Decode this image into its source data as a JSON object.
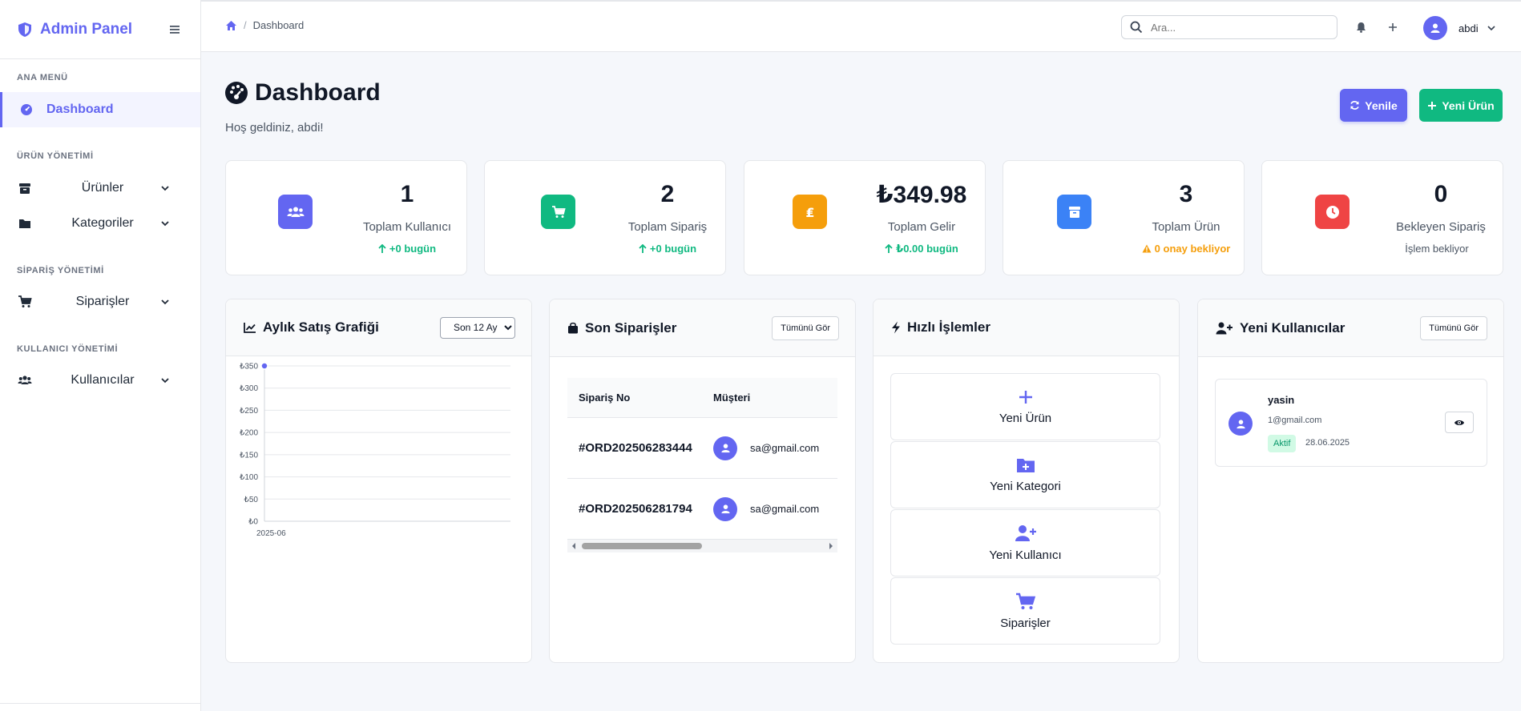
{
  "brand": {
    "title": "Admin Panel"
  },
  "sidebar": {
    "sections": [
      {
        "title": "ANA MENÜ"
      },
      {
        "title": "ÜRÜN YÖNETİMİ"
      },
      {
        "title": "SİPARİŞ YÖNETİMİ"
      },
      {
        "title": "KULLANICI YÖNETİMİ"
      }
    ],
    "items": [
      {
        "label": "Dashboard",
        "icon": "gauge-icon",
        "active": true
      },
      {
        "label": "Ürünler",
        "icon": "box-icon"
      },
      {
        "label": "Kategoriler",
        "icon": "folder-icon"
      },
      {
        "label": "Siparişler",
        "icon": "cart-icon"
      },
      {
        "label": "Kullanıcılar",
        "icon": "users-icon"
      }
    ]
  },
  "topbar": {
    "breadcrumb": "Dashboard",
    "search_placeholder": "Ara...",
    "user_name": "abdi"
  },
  "page": {
    "title": "Dashboard",
    "subtitle": "Hoş geldiniz, abdi!",
    "refresh_label": "Yenile",
    "new_product_label": "Yeni Ürün"
  },
  "stats": [
    {
      "value": "1",
      "label": "Toplam Kullanıcı",
      "sub": "+0 bugün",
      "color": "#6366f1",
      "sub_color": "#10b981"
    },
    {
      "value": "2",
      "label": "Toplam Sipariş",
      "sub": "+0 bugün",
      "color": "#10b981",
      "sub_color": "#10b981"
    },
    {
      "value": "₺349.98",
      "label": "Toplam Gelir",
      "sub": "₺0.00 bugün",
      "color": "#f59e0b",
      "sub_color": "#10b981"
    },
    {
      "value": "3",
      "label": "Toplam Ürün",
      "sub": "0 onay bekliyor",
      "color": "#3b82f6",
      "sub_color": "#f59e0b"
    },
    {
      "value": "0",
      "label": "Bekleyen Sipariş",
      "sub": "İşlem bekliyor",
      "color": "#ef4444",
      "sub_color": "#4b5563"
    }
  ],
  "sales_panel": {
    "title": "Aylık Satış Grafiği",
    "range_selected": "Son 12 Ay"
  },
  "chart_data": {
    "type": "line",
    "categories": [
      "2025-06"
    ],
    "series": [
      {
        "values": [
          349.98
        ],
        "color": "#6366f1"
      }
    ],
    "yticks": [
      "₺0",
      "₺50",
      "₺100",
      "₺150",
      "₺200",
      "₺250",
      "₺300",
      "₺350"
    ],
    "ylim": [
      0,
      350
    ],
    "grid": true
  },
  "orders_panel": {
    "title": "Son Siparişler",
    "view_all": "Tümünü Gör",
    "columns": [
      "Sipariş No",
      "Müşteri"
    ],
    "rows": [
      {
        "order_no": "#ORD202506283444",
        "customer": "sa@gmail.com"
      },
      {
        "order_no": "#ORD202506281794",
        "customer": "sa@gmail.com"
      }
    ]
  },
  "quick_panel": {
    "title": "Hızlı İşlemler",
    "actions": [
      {
        "label": "Yeni Ürün",
        "icon": "plus-icon"
      },
      {
        "label": "Yeni Kategori",
        "icon": "folder-plus-icon"
      },
      {
        "label": "Yeni Kullanıcı",
        "icon": "user-plus-icon"
      },
      {
        "label": "Siparişler",
        "icon": "cart-icon"
      }
    ]
  },
  "users_panel": {
    "title": "Yeni Kullanıcılar",
    "view_all": "Tümünü Gör",
    "users": [
      {
        "name": "yasin",
        "email": "1@gmail.com",
        "status": "Aktif",
        "date": "28.06.2025"
      }
    ]
  }
}
